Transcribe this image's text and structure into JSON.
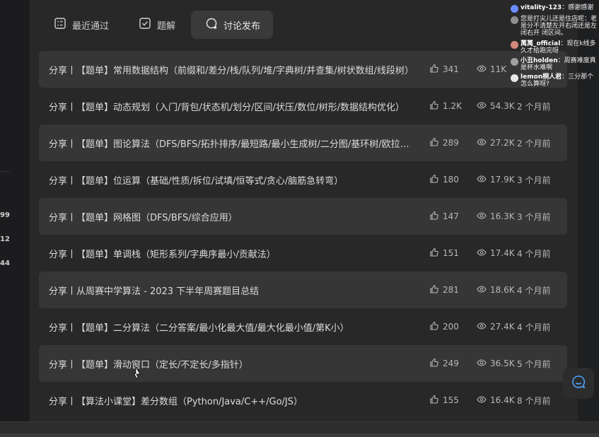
{
  "left_numbers": [
    "99",
    "12",
    "44"
  ],
  "tabs": [
    {
      "label": "最近通过",
      "icon": "list-icon",
      "active": false
    },
    {
      "label": "题解",
      "icon": "check-square-icon",
      "active": false
    },
    {
      "label": "讨论发布",
      "icon": "discussion-icon",
      "active": true
    }
  ],
  "rows": [
    {
      "title": "分享丨【题单】常用数据结构（前缀和/差分/栈/队列/堆/字典树/并查集/树状数组/线段树）",
      "likes": "341",
      "views": "11K",
      "time": ""
    },
    {
      "title": "分享丨【题单】动态规划（入门/背包/状态机/划分/区间/状压/数位/树形/数据结构优化）",
      "likes": "1.2K",
      "views": "54.3K",
      "time": "2 个月前"
    },
    {
      "title": "分享丨【题单】图论算法（DFS/BFS/拓扑排序/最短路/最小生成树/二分图/基环树/欧拉路径）",
      "likes": "289",
      "views": "27.2K",
      "time": "2 个月前"
    },
    {
      "title": "分享丨【题单】位运算（基础/性质/拆位/试填/恒等式/贪心/脑筋急转弯）",
      "likes": "180",
      "views": "17.9K",
      "time": "3 个月前"
    },
    {
      "title": "分享丨【题单】网格图（DFS/BFS/综合应用）",
      "likes": "147",
      "views": "16.3K",
      "time": "3 个月前"
    },
    {
      "title": "分享丨【题单】单调栈（矩形系列/字典序最小/贡献法）",
      "likes": "151",
      "views": "17.4K",
      "time": "4 个月前"
    },
    {
      "title": "分享丨从周赛中学算法 - 2023 下半年周赛题目总结",
      "likes": "281",
      "views": "18.6K",
      "time": "4 个月前"
    },
    {
      "title": "分享丨【题单】二分算法（二分答案/最小化最大值/最大化最小值/第K小）",
      "likes": "200",
      "views": "27.4K",
      "time": "4 个月前"
    },
    {
      "title": "分享丨【题单】滑动窗口（定长/不定长/多指针）",
      "likes": "249",
      "views": "36.5K",
      "time": "5 个月前"
    },
    {
      "title": "分享丨【算法小课堂】差分数组（Python/Java/C++/Go/JS）",
      "likes": "155",
      "views": "16.4K",
      "time": "8 个月前"
    }
  ],
  "chat": [
    {
      "name": "vitality-123",
      "text": "：感谢感谢",
      "color": "#6b8cff"
    },
    {
      "name": "",
      "text": "您是打尖儿还是住店呢：老是分不清楚左开右闭还是左闭右开 闭区间。",
      "color": "#8f8f8f"
    },
    {
      "name": "萬萬_official",
      "text": "：现在k线多久才给跑完呀",
      "color": "#d08a7a"
    },
    {
      "name": "小丑holden",
      "text": "：周赛难度真是杯水难啊",
      "color": "#a0a0a0"
    },
    {
      "name": "lemon桐人君",
      "text": "：三分那个怎么算呀?",
      "color": "#e8e8e8"
    }
  ],
  "accent_color": "#4aa3ff"
}
